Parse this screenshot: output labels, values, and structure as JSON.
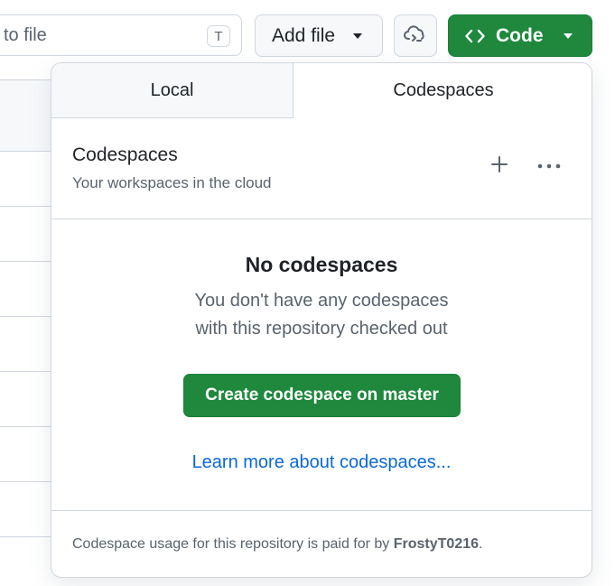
{
  "toolbar": {
    "goto_placeholder": "to file",
    "goto_shortcut": "T",
    "add_file_label": "Add file",
    "code_label": "Code"
  },
  "panel": {
    "tabs": [
      {
        "label": "Local",
        "selected": false
      },
      {
        "label": "Codespaces",
        "selected": true
      }
    ],
    "header": {
      "title": "Codespaces",
      "subtitle": "Your workspaces in the cloud"
    },
    "empty": {
      "title": "No codespaces",
      "desc_line1": "You don't have any codespaces",
      "desc_line2": "with this repository checked out",
      "create_button": "Create codespace on master",
      "learn_link": "Learn more about codespaces..."
    },
    "footer": {
      "prefix": "Codespace usage for this repository is paid for by ",
      "owner": "FrostyT0216",
      "suffix": "."
    }
  },
  "colors": {
    "primary_green": "#1f883d",
    "link_blue": "#0969da",
    "muted_text": "#59636e",
    "border": "#d0d7de"
  },
  "icons": {
    "codespace_button": "cloud-code-icon",
    "code_button": "code-brackets-icon",
    "new_codespace": "plus-icon",
    "more_options": "kebab-horizontal-icon"
  }
}
